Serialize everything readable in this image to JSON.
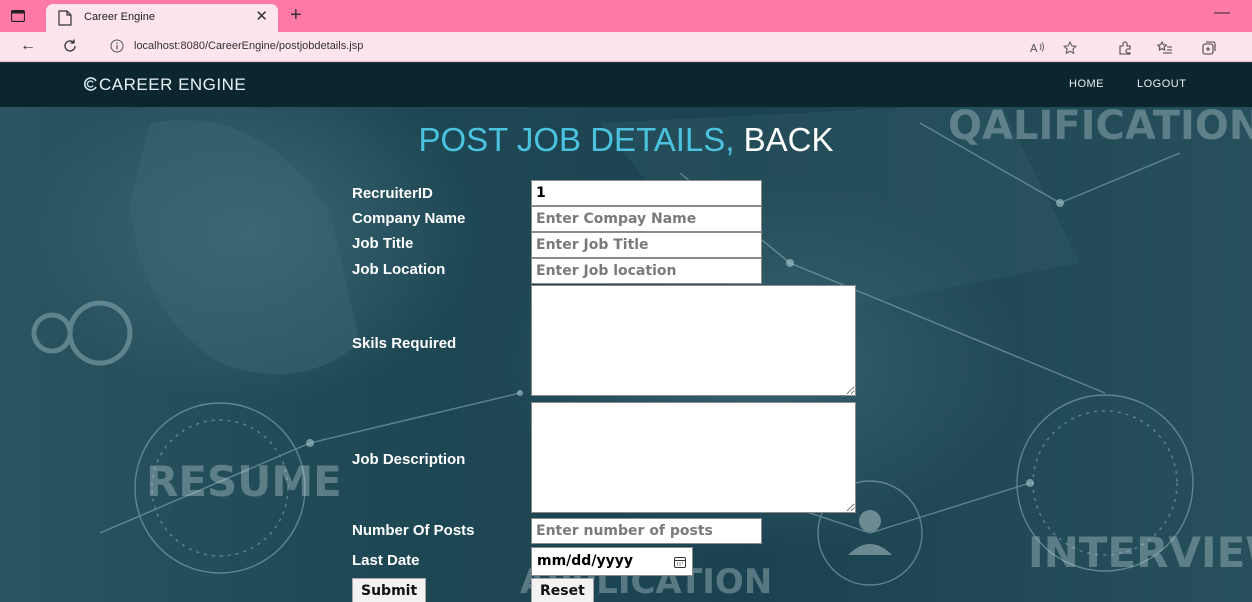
{
  "browser": {
    "tab_title": "Career Engine",
    "url": "localhost:8080/CareerEngine/postjobdetails.jsp"
  },
  "navbar": {
    "brand": "CAREER ENGINE",
    "links": [
      "HOME",
      "LOGOUT"
    ]
  },
  "heading": {
    "part1": "POST JOB DETAILS,",
    "part2": "BACK"
  },
  "form": {
    "recruiter_id": {
      "label": "RecruiterID",
      "value": "1"
    },
    "company_name": {
      "label": "Company Name",
      "placeholder": "Enter Compay Name"
    },
    "job_title": {
      "label": "Job Title",
      "placeholder": "Enter Job Title"
    },
    "job_location": {
      "label": "Job Location",
      "placeholder": "Enter Job location"
    },
    "skills": {
      "label": "Skils Required"
    },
    "description": {
      "label": "Job Description"
    },
    "posts": {
      "label": "Number Of Posts",
      "placeholder": "Enter number of posts"
    },
    "last_date": {
      "label": "Last Date",
      "placeholder": "mm/dd/yyyy"
    },
    "submit": "Submit",
    "reset": "Reset"
  },
  "background": {
    "words": [
      "QALIFICATION",
      "RESUME",
      "INTERVIEW",
      "APPLICATION"
    ]
  },
  "colors": {
    "tabbar": "#ff79a8",
    "addrbar": "#fde4ee",
    "navbar": "#0c2630",
    "heading_accent": "#4bc2de"
  }
}
